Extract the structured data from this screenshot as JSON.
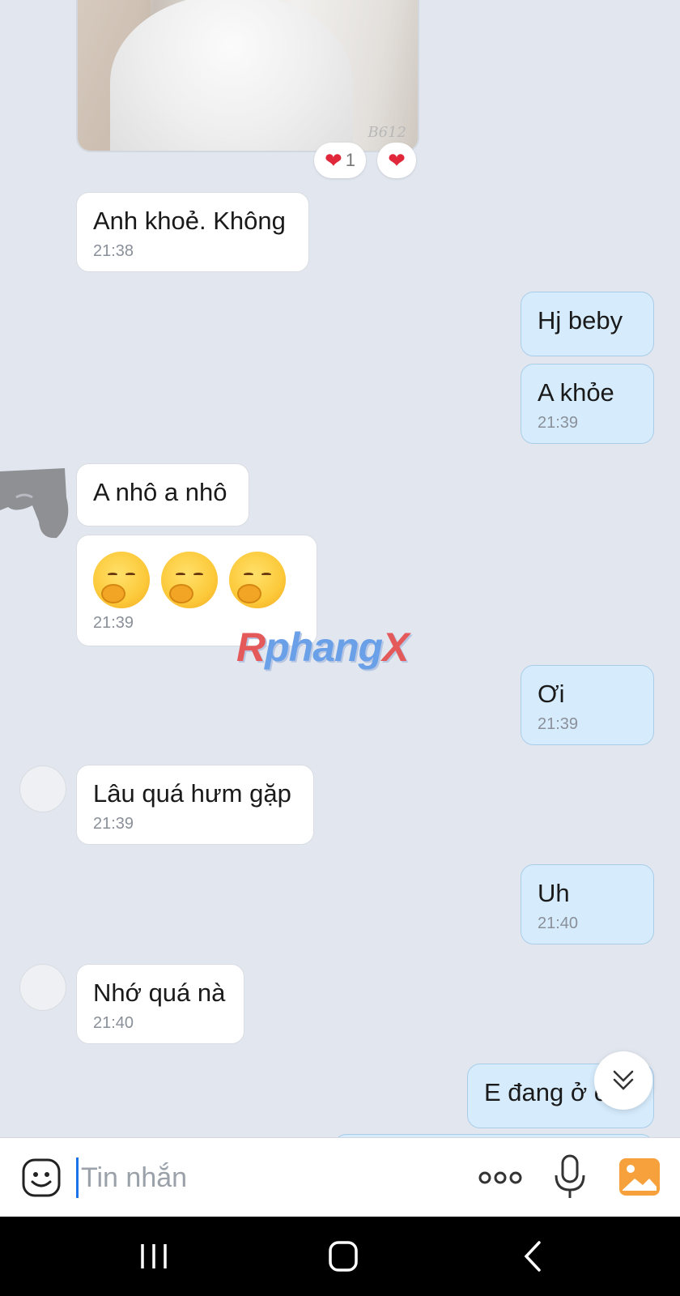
{
  "photo": {
    "watermark": "B612"
  },
  "reactions": {
    "count": "1"
  },
  "messages": [
    {
      "side": "in",
      "text": "Anh khoẻ. Không",
      "time": "21:38"
    },
    {
      "side": "out",
      "text": "Hj beby",
      "time": ""
    },
    {
      "side": "out",
      "text": "A khỏe",
      "time": "21:39"
    },
    {
      "side": "in",
      "text": "A nhô a nhô",
      "time": ""
    },
    {
      "side": "in",
      "text": "",
      "emoji_count": 3,
      "time": "21:39"
    },
    {
      "side": "out",
      "text": "Ơi",
      "time": "21:39"
    },
    {
      "side": "in",
      "text": "Lâu quá hưm gặp",
      "time": "21:39"
    },
    {
      "side": "out",
      "text": "Uh",
      "time": "21:40"
    },
    {
      "side": "in",
      "text": "Nhớ quá nà",
      "time": "21:40"
    },
    {
      "side": "out",
      "text": "E đang ở c",
      "time": ""
    }
  ],
  "watermark": {
    "part1": "R",
    "part2": "phang",
    "part3": "X"
  },
  "composer": {
    "placeholder": "Tin nhắn"
  },
  "colors": {
    "in_bubble": "#ffffff",
    "out_bubble": "#d6ecfd",
    "background": "#e2e7ef",
    "accent": "#f6a13b"
  }
}
